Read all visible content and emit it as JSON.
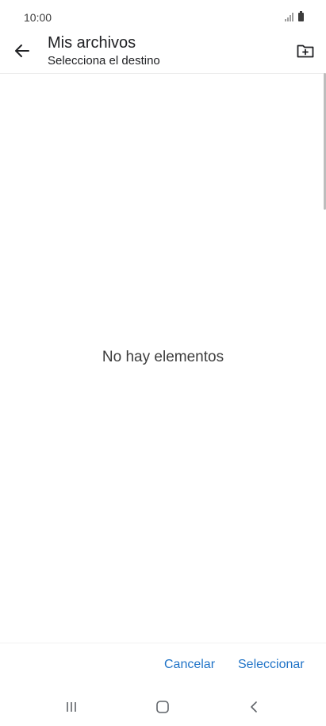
{
  "status_bar": {
    "time": "10:00",
    "icons": [
      "signal-icon",
      "battery-icon"
    ]
  },
  "app_bar": {
    "title": "Mis archivos",
    "subtitle": "Selecciona el destino",
    "icons": [
      "arrow-back-icon",
      "new-folder-icon"
    ]
  },
  "content": {
    "empty_message": "No hay elementos"
  },
  "actions": {
    "cancel_label": "Cancelar",
    "select_label": "Seleccionar",
    "accent_color": "#1f73c7"
  },
  "nav_bar": {
    "icons": [
      "recents-icon",
      "home-icon",
      "back-icon"
    ]
  }
}
